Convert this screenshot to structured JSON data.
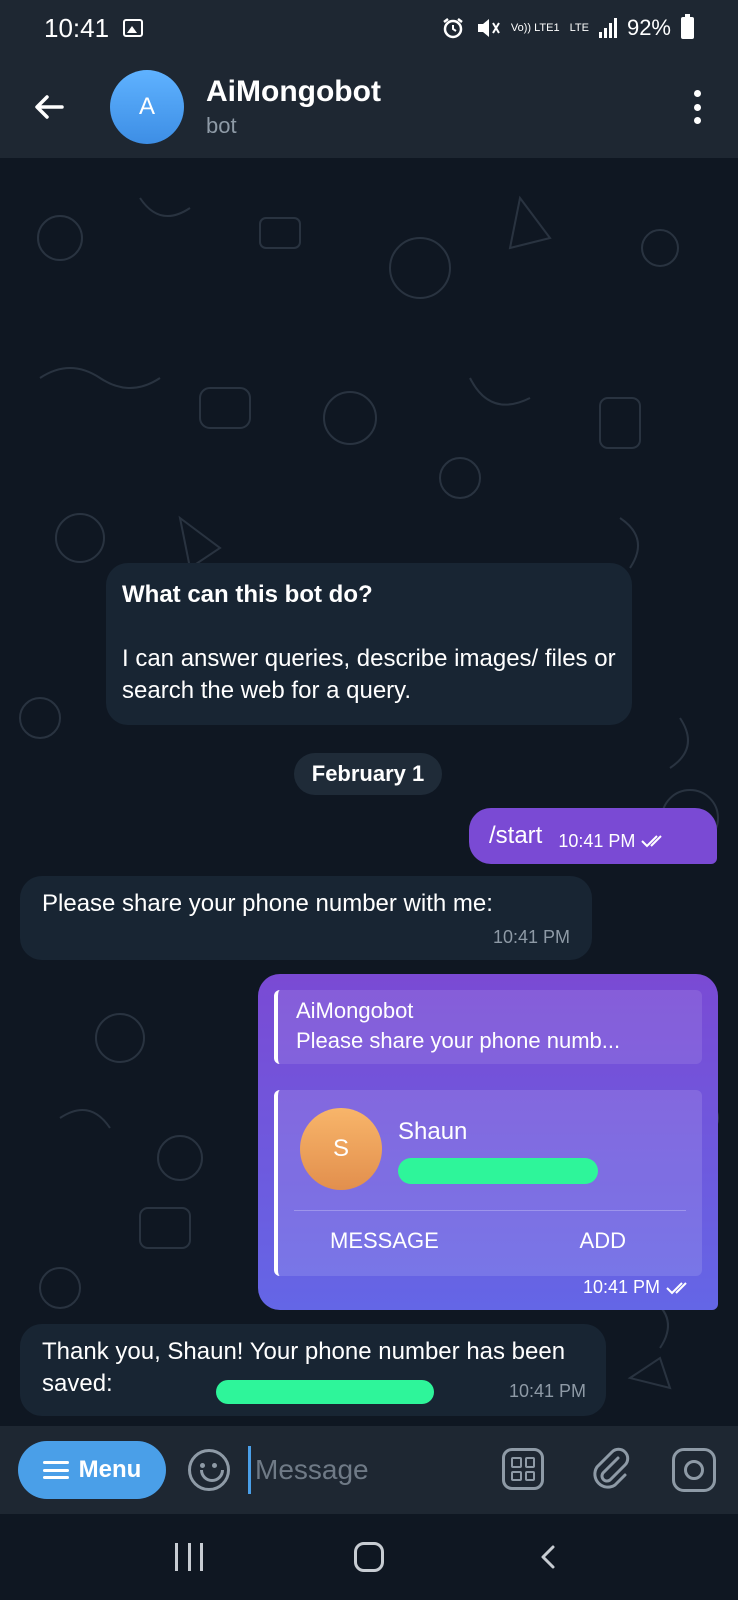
{
  "status_bar": {
    "time": "10:41",
    "volte": "Vo)) LTE1",
    "lte": "LTE",
    "battery": "92%"
  },
  "header": {
    "avatar_letter": "A",
    "title": "AiMongobot",
    "subtitle": "bot"
  },
  "intro_card": {
    "question": "What can this bot do?",
    "answer": "I can answer queries, describe images/ files or search the web for a query."
  },
  "date_chip": "February 1",
  "messages": {
    "start": {
      "text": "/start",
      "time": "10:41 PM"
    },
    "request": {
      "text": "Please share your phone number with me:",
      "time": "10:41 PM"
    },
    "contact": {
      "reply_name": "AiMongobot",
      "reply_text": "Please share your phone numb...",
      "contact_letter": "S",
      "contact_name": "Shaun",
      "message_label": "MESSAGE",
      "add_label": "ADD",
      "time": "10:41 PM"
    },
    "thanks": {
      "text": "Thank you, Shaun! Your phone number has been saved:",
      "time": "10:41 PM"
    }
  },
  "input_bar": {
    "menu_label": "Menu",
    "placeholder": "Message"
  },
  "icons": {
    "back": "arrow-left-icon",
    "more": "more-vertical-icon",
    "emoji": "emoji-icon",
    "bot_commands": "bot-commands-icon",
    "attach": "paperclip-icon",
    "camera": "camera-icon"
  },
  "colors": {
    "background": "#0e1621",
    "incoming_bubble": "#182533",
    "outgoing_bubble": "#7a4ad4",
    "accent": "#4a9fe8"
  }
}
